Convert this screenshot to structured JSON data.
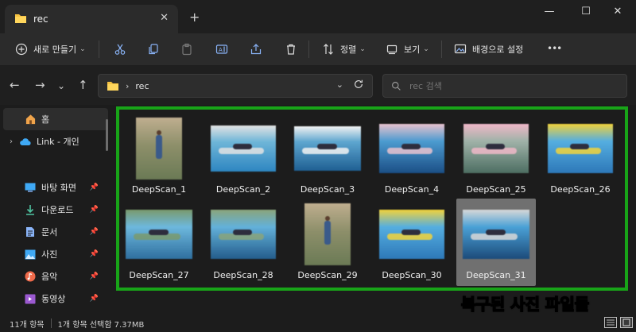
{
  "tab": {
    "title": "rec",
    "close": "✕",
    "new": "+"
  },
  "window": {
    "minimize": "—",
    "maximize": "☐",
    "close": "✕"
  },
  "toolbar": {
    "new_label": "새로 만들기",
    "sort_label": "정렬",
    "view_label": "보기",
    "background_label": "배경으로 설정",
    "more": "•••"
  },
  "address": {
    "folder": "rec",
    "separator": "›"
  },
  "search": {
    "placeholder": "rec 검색"
  },
  "sidebar": {
    "home": "홈",
    "link": "Link - 개인",
    "items": [
      {
        "label": "바탕 화면",
        "icon": "desktop-icon",
        "color": "#3fa9f5"
      },
      {
        "label": "다운로드",
        "icon": "download-icon",
        "color": "#4fc3a1"
      },
      {
        "label": "문서",
        "icon": "document-icon",
        "color": "#8ab4f8"
      },
      {
        "label": "사진",
        "icon": "pictures-icon",
        "color": "#3fa9f5"
      },
      {
        "label": "음악",
        "icon": "music-icon",
        "color": "#f06a4a"
      },
      {
        "label": "동영상",
        "icon": "video-icon",
        "color": "#9b59d0"
      }
    ]
  },
  "files": [
    {
      "name": "DeepScan_1",
      "kind": "portrait-person"
    },
    {
      "name": "DeepScan_2",
      "kind": "pool-board"
    },
    {
      "name": "DeepScan_3",
      "kind": "pool-lying"
    },
    {
      "name": "DeepScan_4",
      "kind": "pool-close"
    },
    {
      "name": "DeepScan_25",
      "kind": "lake-boat"
    },
    {
      "name": "DeepScan_26",
      "kind": "pool-yellow"
    },
    {
      "name": "DeepScan_27",
      "kind": "pool-wide"
    },
    {
      "name": "DeepScan_28",
      "kind": "pool-board2"
    },
    {
      "name": "DeepScan_29",
      "kind": "portrait-person"
    },
    {
      "name": "DeepScan_30",
      "kind": "pool-yellow"
    },
    {
      "name": "DeepScan_31",
      "kind": "pool-selected",
      "selected": true
    }
  ],
  "overlay_text": "복구된 사진 파일들",
  "status": {
    "count": "11개 항목",
    "selection": "1개 항목 선택함 7.37MB"
  },
  "colors": {
    "accent_green": "#18a418",
    "overlay_green": "#27e627",
    "folder_yellow": "#f5c242"
  }
}
